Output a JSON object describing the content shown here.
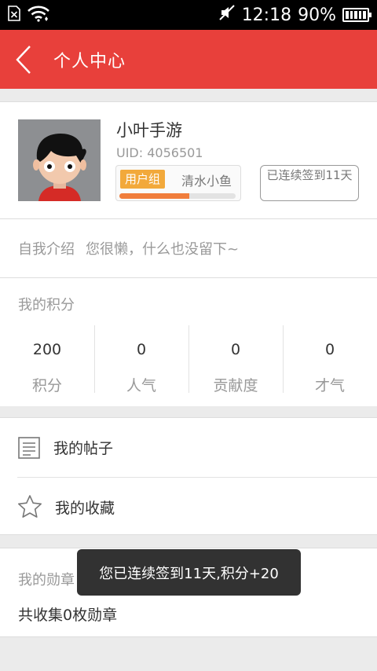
{
  "status_bar": {
    "time": "12:18",
    "battery": "90%",
    "icons": [
      "sim-card-icon",
      "wifi-icon",
      "mute-icon",
      "battery-icon"
    ]
  },
  "header": {
    "title": "个人中心",
    "back_icon": "chevron-left-icon"
  },
  "profile": {
    "nickname": "小叶手游",
    "uid": "UID: 4056501",
    "group_label": "用户组",
    "group_name": "清水小鱼",
    "level_progress": 0.6,
    "sign_in": "已连续签到11天"
  },
  "intro": {
    "label": "自我介绍",
    "text": "您很懒，什么也没留下~"
  },
  "points": {
    "title": "我的积分",
    "stats": [
      {
        "value": "200",
        "label": "积分"
      },
      {
        "value": "0",
        "label": "人气"
      },
      {
        "value": "0",
        "label": "贡献度"
      },
      {
        "value": "0",
        "label": "才气"
      }
    ]
  },
  "menu": {
    "posts": "我的帖子",
    "favorites": "我的收藏"
  },
  "medals": {
    "title": "我的勋章",
    "count_text": "共收集0枚勋章"
  },
  "toast": {
    "text": "您已连续签到11天,积分+20"
  },
  "colors": {
    "brand": "#e8403b",
    "badge": "#f2a93b",
    "progress": "#f07d3b"
  }
}
